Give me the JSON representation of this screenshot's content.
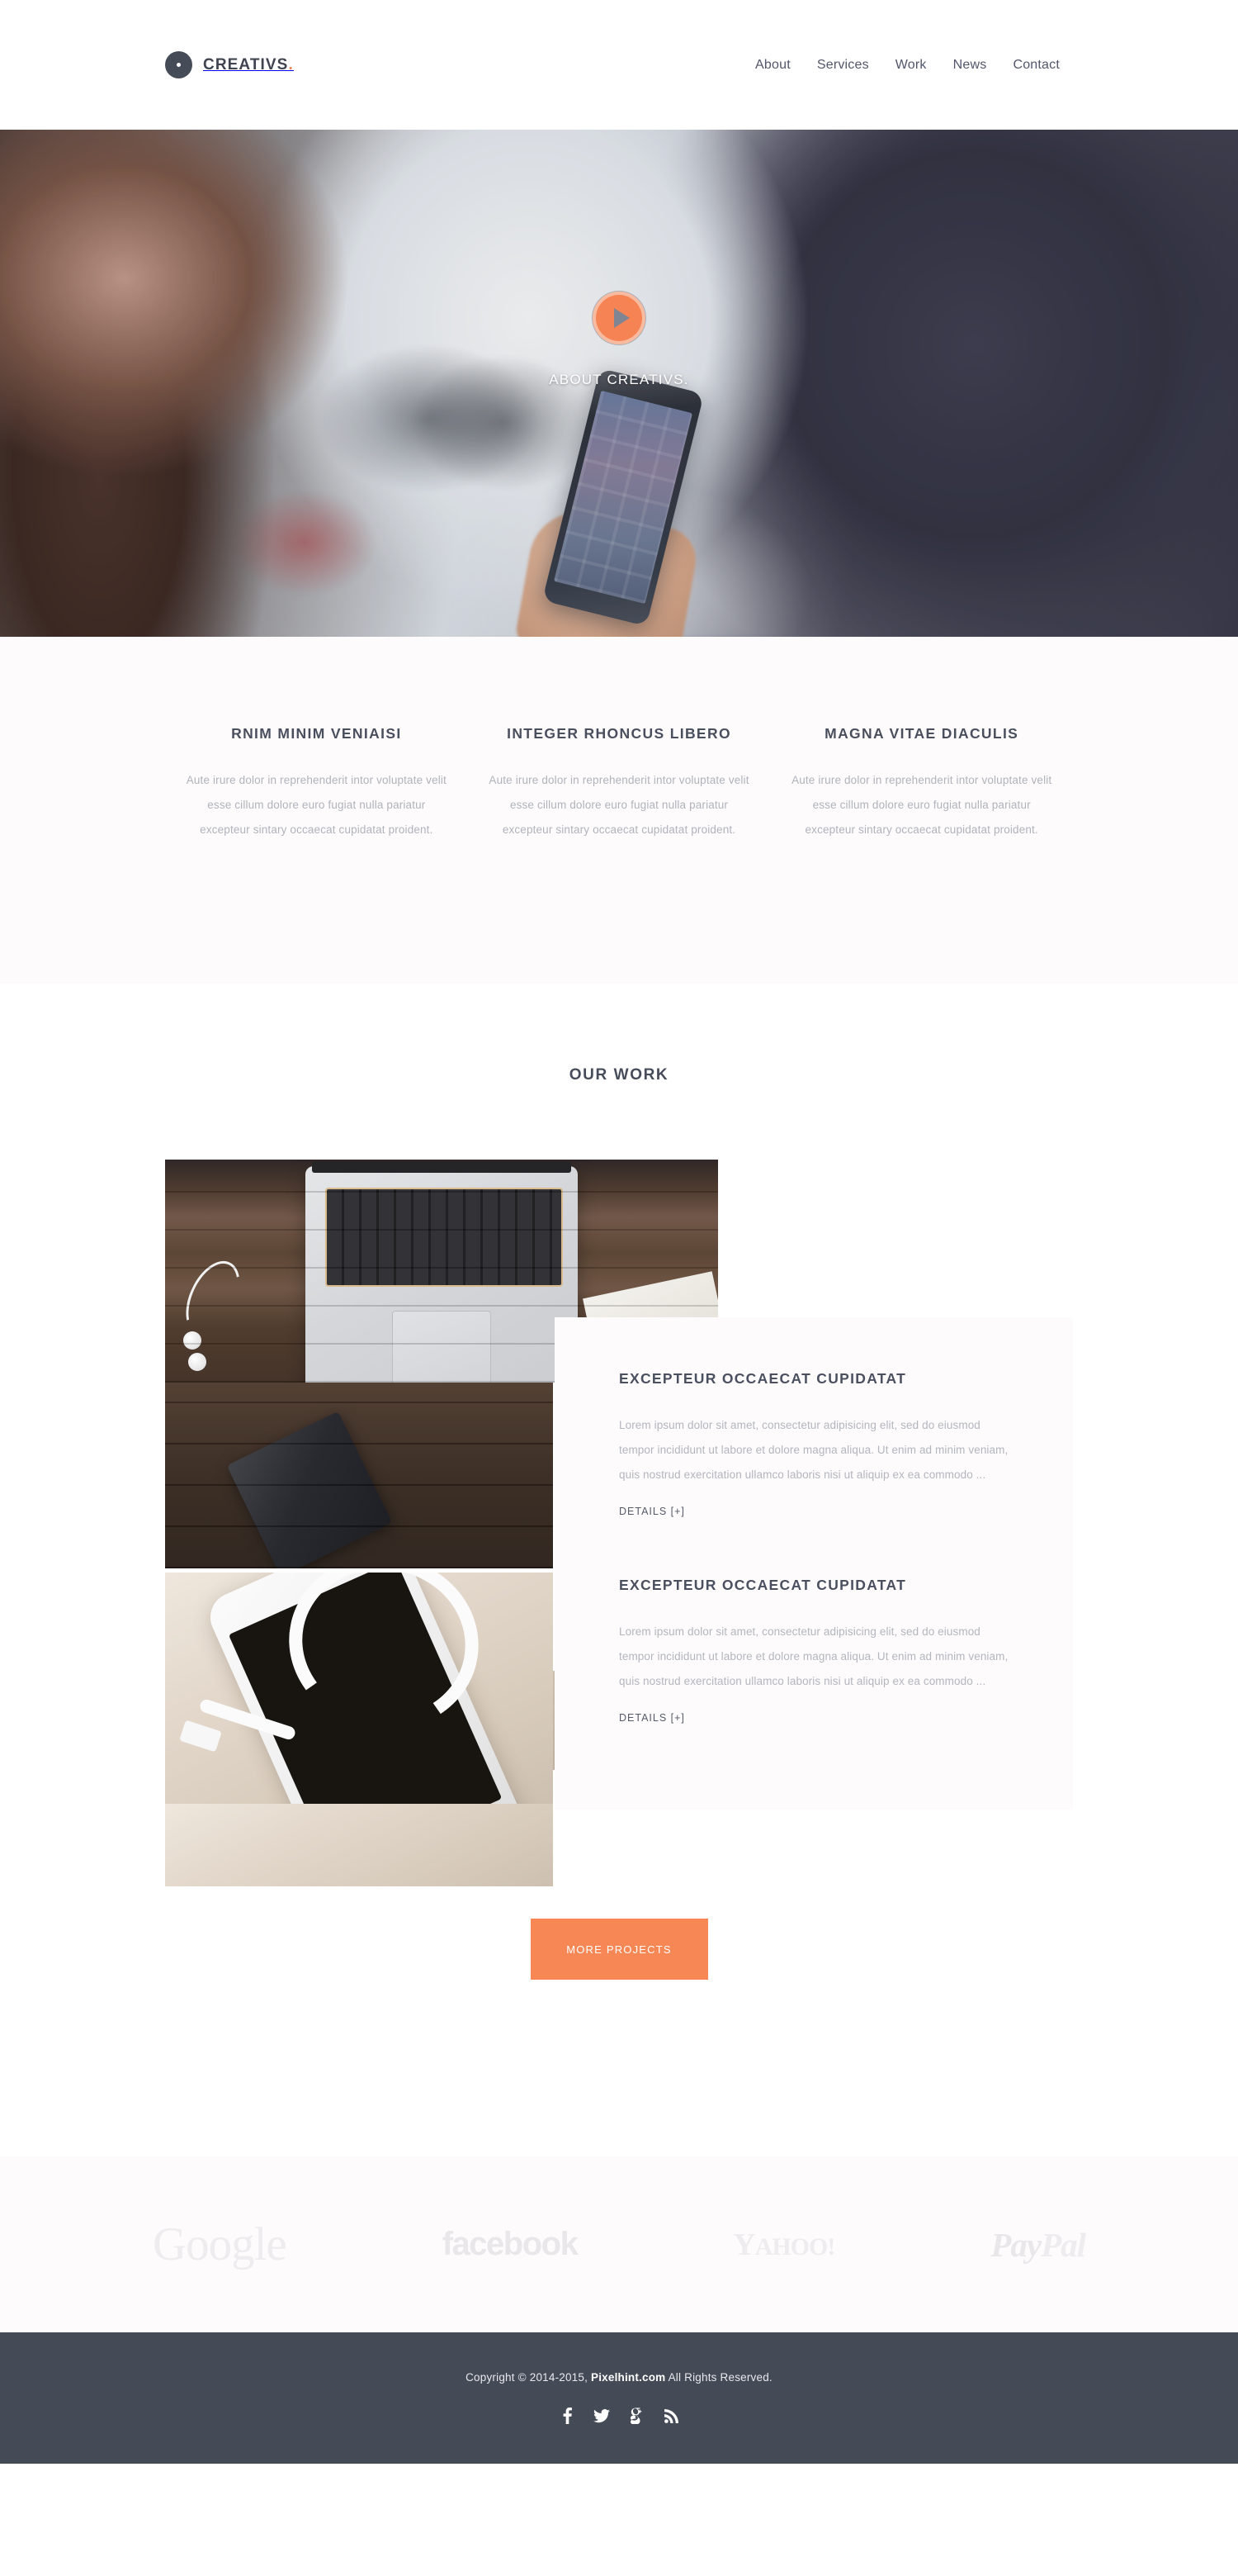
{
  "header": {
    "logo": {
      "text": "CREATIVS",
      "accent_dot": ".",
      "mark": "circle-dot-logo"
    },
    "nav": [
      {
        "label": "About"
      },
      {
        "label": "Services"
      },
      {
        "label": "Work"
      },
      {
        "label": "News"
      },
      {
        "label": "Contact"
      }
    ]
  },
  "hero": {
    "caption": "ABOUT CREATIVS.",
    "play_button": "play-icon",
    "accent_color": "#f58353"
  },
  "features": [
    {
      "title": "RNIM MINIM VENIAISI",
      "body": "Aute irure dolor in reprehenderit intor voluptate velit esse cillum dolore euro fugiat nulla pariatur excepteur sintary occaecat cupidatat proident."
    },
    {
      "title": "INTEGER RHONCUS LIBERO",
      "body": "Aute irure dolor in reprehenderit intor voluptate velit esse cillum dolore euro fugiat nulla pariatur excepteur sintary occaecat cupidatat proident."
    },
    {
      "title": "MAGNA VITAE DIACULIS",
      "body": "Aute irure dolor in reprehenderit intor voluptate velit esse cillum dolore euro fugiat nulla pariatur excepteur sintary occaecat cupidatat proident."
    }
  ],
  "work": {
    "title": "OUR WORK",
    "projects": [
      {
        "title": "EXCEPTEUR OCCAECAT CUPIDATAT",
        "body": "Lorem ipsum dolor sit amet, consectetur adipisicing elit, sed do eiusmod tempor incididunt ut labore et dolore magna aliqua. Ut enim ad minim veniam, quis nostrud exercitation ullamco laboris nisi ut aliquip ex ea commodo ...",
        "details_label": "DETAILS [+]"
      },
      {
        "title": "EXCEPTEUR OCCAECAT CUPIDATAT",
        "body": "Lorem ipsum dolor sit amet, consectetur adipisicing elit, sed do eiusmod tempor incididunt ut labore et dolore magna aliqua. Ut enim ad minim veniam, quis nostrud exercitation ullamco laboris nisi ut aliquip ex ea commodo ...",
        "details_label": "DETAILS [+]"
      }
    ],
    "more_button": "MORE PROJECTS",
    "button_color": "#f78855"
  },
  "clients": [
    {
      "name": "Google"
    },
    {
      "name": "facebook"
    },
    {
      "name": "Yahoo",
      "part1": "Y",
      "part2": "AHOO!"
    },
    {
      "name": "PayPal",
      "part1": "Pay",
      "part2": "Pal"
    }
  ],
  "footer": {
    "copyright_prefix": "Copyright © 2014-2015, ",
    "brand": "Pixelhint.com",
    "copyright_suffix": " All Rights Reserved.",
    "background": "#454a57",
    "social": [
      {
        "name": "facebook-icon"
      },
      {
        "name": "twitter-icon"
      },
      {
        "name": "google-plus-icon"
      },
      {
        "name": "rss-icon"
      }
    ]
  }
}
